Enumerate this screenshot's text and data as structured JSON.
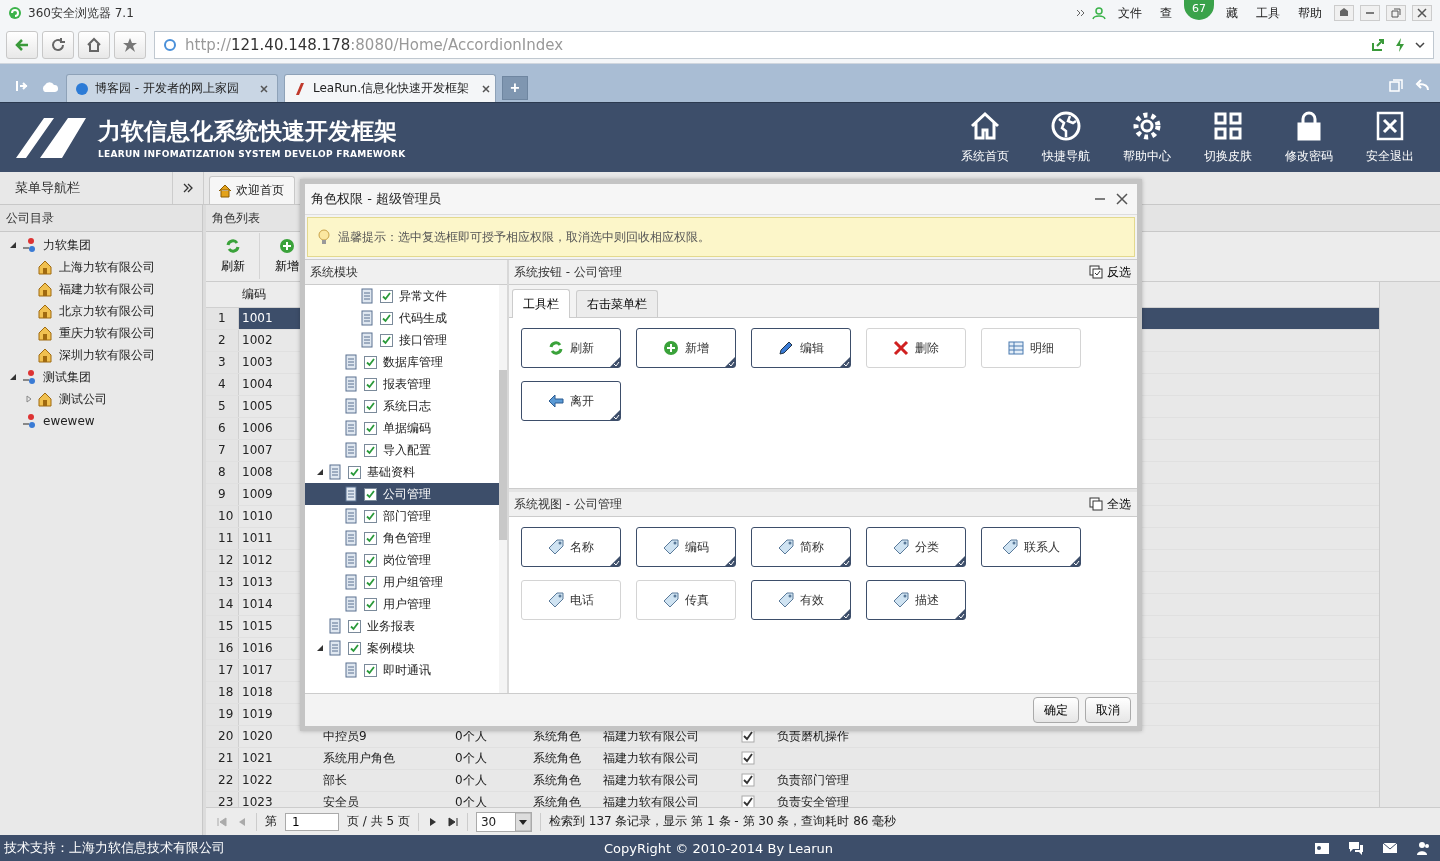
{
  "browser": {
    "title": "360安全浏览器 7.1",
    "menu_left": [
      "文件",
      "查"
    ],
    "badge": "67",
    "menu_right": [
      "藏",
      "工具",
      "帮助"
    ],
    "url": {
      "scheme": "http://",
      "host": "121.40.148.178",
      "path": ":8080/Home/AccordionIndex"
    },
    "tabs": [
      {
        "label": "博客园 - 开发者的网上家园",
        "selected": false
      },
      {
        "label": "LeaRun.信息化快速开发框架",
        "selected": true
      }
    ],
    "new_tab": "+"
  },
  "app": {
    "title": "力软信息化系统快速开发框架",
    "subtitle": "LEARUN INFOMATIZATION SYSTEM DEVELOP FRAMEWORK",
    "nav": [
      {
        "label": "系统首页",
        "kind": "home"
      },
      {
        "label": "快捷导航",
        "kind": "globe"
      },
      {
        "label": "帮助中心",
        "kind": "gear"
      },
      {
        "label": "切换皮肤",
        "kind": "grid"
      },
      {
        "label": "修改密码",
        "kind": "lock"
      },
      {
        "label": "安全退出",
        "kind": "exit"
      }
    ]
  },
  "menu_bar": {
    "label": "菜单导航栏",
    "tabs": [
      {
        "label": "欢迎首页",
        "selected": true
      }
    ]
  },
  "company_panel": {
    "title": "公司目录",
    "tree": [
      {
        "label": "力软集团",
        "kind": "group",
        "expanded": true,
        "children": [
          {
            "label": "上海力软有限公司",
            "kind": "company"
          },
          {
            "label": "福建力软有限公司",
            "kind": "company"
          },
          {
            "label": "北京力软有限公司",
            "kind": "company"
          },
          {
            "label": "重庆力软有限公司",
            "kind": "company"
          },
          {
            "label": "深圳力软有限公司",
            "kind": "company"
          }
        ]
      },
      {
        "label": "测试集团",
        "kind": "group",
        "expanded": true,
        "children": [
          {
            "label": "测试公司",
            "kind": "company",
            "expanded": false
          }
        ]
      },
      {
        "label": "ewewew",
        "kind": "group"
      }
    ]
  },
  "role_panel": {
    "title": "角色列表",
    "toolbar": [
      {
        "label": "刷新",
        "kind": "refresh"
      },
      {
        "label": "新增",
        "kind": "add"
      }
    ],
    "columns": [
      "编码"
    ],
    "rows": [
      {
        "num": "1",
        "code": "1001",
        "selected": true
      },
      {
        "num": "2",
        "code": "1002",
        "selected": false
      },
      {
        "num": "3",
        "code": "1003",
        "selected": false
      },
      {
        "num": "4",
        "code": "1004",
        "selected": false
      },
      {
        "num": "5",
        "code": "1005",
        "selected": false
      },
      {
        "num": "6",
        "code": "1006",
        "selected": false
      },
      {
        "num": "7",
        "code": "1007",
        "selected": false
      },
      {
        "num": "8",
        "code": "1008",
        "selected": false
      },
      {
        "num": "9",
        "code": "1009",
        "selected": false
      },
      {
        "num": "10",
        "code": "1010",
        "selected": false
      },
      {
        "num": "11",
        "code": "1011",
        "selected": false
      },
      {
        "num": "12",
        "code": "1012",
        "selected": false
      },
      {
        "num": "13",
        "code": "1013",
        "selected": false
      },
      {
        "num": "14",
        "code": "1014",
        "selected": false
      },
      {
        "num": "15",
        "code": "1015",
        "selected": false
      },
      {
        "num": "16",
        "code": "1016",
        "selected": false
      },
      {
        "num": "17",
        "code": "1017",
        "selected": false
      },
      {
        "num": "18",
        "code": "1018",
        "selected": false
      },
      {
        "num": "19",
        "code": "1019",
        "selected": false
      },
      {
        "num": "20",
        "code": "1020",
        "name": "中控员9",
        "count": "0个人",
        "type": "系统角色",
        "company": "福建力软有限公司",
        "enabled": true,
        "desc": "负责磨机操作",
        "selected": false
      },
      {
        "num": "21",
        "code": "1021",
        "name": "系统用户角色",
        "count": "0个人",
        "type": "系统角色",
        "company": "福建力软有限公司",
        "enabled": true,
        "selected": false
      },
      {
        "num": "22",
        "code": "1022",
        "name": "部长",
        "count": "0个人",
        "type": "系统角色",
        "company": "福建力软有限公司",
        "enabled": true,
        "desc": "负责部门管理",
        "selected": false
      },
      {
        "num": "23",
        "code": "1023",
        "name": "安全员",
        "count": "0个人",
        "type": "系统角色",
        "company": "福建力软有限公司",
        "enabled": true,
        "desc": "负责安全管理",
        "selected": false
      }
    ],
    "pager": {
      "page_label": "第",
      "page": "1",
      "total": "页 / 共 5 页",
      "size": "30",
      "summary": "检索到 137 条记录，显示 第 1 条 - 第 30 条，查询耗时 86 毫秒"
    }
  },
  "footer": {
    "support": "技术支持：上海力软信息技术有限公司",
    "copyright": "CopyRight © 2010-2014 By Learun"
  },
  "dialog": {
    "title": "角色权限 - 超级管理员",
    "hint": "温馨提示：选中复选框即可授予相应权限，取消选中则回收相应权限。",
    "module_title": "系统模块",
    "tree": [
      {
        "children": [
          {
            "children": [
              {
                "label": "异常文件",
                "checked": true,
                "selected": false
              },
              {
                "label": "代码生成",
                "checked": true,
                "selected": false
              },
              {
                "label": "接口管理",
                "checked": true,
                "selected": false
              }
            ]
          },
          {
            "label": "数据库管理",
            "checked": true,
            "selected": false
          },
          {
            "label": "报表管理",
            "checked": true,
            "selected": false
          },
          {
            "label": "系统日志",
            "checked": true,
            "selected": false
          },
          {
            "label": "单据编码",
            "checked": true,
            "selected": false
          },
          {
            "label": "导入配置",
            "checked": true,
            "selected": false
          }
        ]
      },
      {
        "label": "基础资料",
        "checked": true,
        "selected": false,
        "expanded": true,
        "children": [
          {
            "label": "公司管理",
            "checked": true,
            "selected": true
          },
          {
            "label": "部门管理",
            "checked": true,
            "selected": false
          },
          {
            "label": "角色管理",
            "checked": true,
            "selected": false
          },
          {
            "label": "岗位管理",
            "checked": true,
            "selected": false
          },
          {
            "label": "用户组管理",
            "checked": true,
            "selected": false
          },
          {
            "label": "用户管理",
            "checked": true,
            "selected": false
          }
        ]
      },
      {
        "label": "业务报表",
        "checked": true,
        "selected": false
      },
      {
        "label": "案例模块",
        "checked": true,
        "selected": false,
        "expanded": true,
        "children": [
          {
            "label": "即时通讯",
            "checked": true,
            "selected": false
          }
        ]
      }
    ],
    "button_panel": {
      "title": "系统按钮 - 公司管理",
      "action": "反选",
      "tabs": [
        {
          "label": "工具栏",
          "selected": true
        },
        {
          "label": "右击菜单栏",
          "selected": false
        }
      ],
      "buttons": [
        {
          "label": "刷新",
          "kind": "refresh",
          "checked": true
        },
        {
          "label": "新增",
          "kind": "add",
          "checked": true
        },
        {
          "label": "编辑",
          "kind": "edit",
          "checked": true
        },
        {
          "label": "删除",
          "kind": "delete",
          "checked": false
        },
        {
          "label": "明细",
          "kind": "detail",
          "checked": false
        },
        {
          "label": "离开",
          "kind": "back",
          "checked": true
        }
      ]
    },
    "view_panel": {
      "title": "系统视图 - 公司管理",
      "action": "全选",
      "fields": [
        {
          "label": "名称",
          "checked": true
        },
        {
          "label": "编码",
          "checked": true
        },
        {
          "label": "简称",
          "checked": true
        },
        {
          "label": "分类",
          "checked": true
        },
        {
          "label": "联系人",
          "checked": true
        },
        {
          "label": "电话",
          "checked": false
        },
        {
          "label": "传真",
          "checked": false
        },
        {
          "label": "有效",
          "checked": true
        },
        {
          "label": "描述",
          "checked": true
        }
      ]
    },
    "footer_buttons": [
      "确定",
      "取消"
    ]
  }
}
